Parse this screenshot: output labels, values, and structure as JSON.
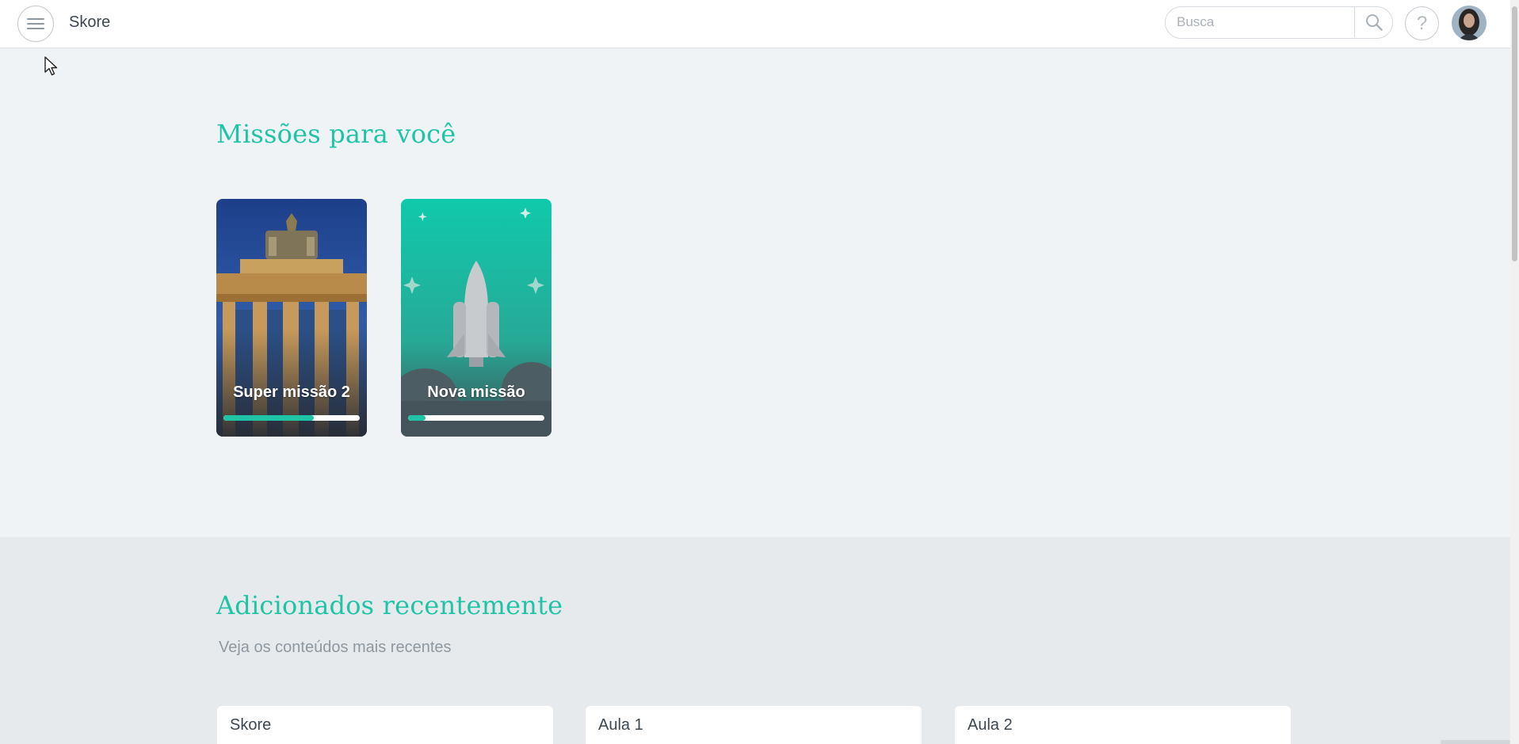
{
  "header": {
    "app_name": "Skore",
    "search_placeholder": "Busca",
    "help_label": "?"
  },
  "missions": {
    "title": "Missões para você",
    "cards": [
      {
        "title": "Super missão 2",
        "progress": 0.66
      },
      {
        "title": "Nova missão",
        "progress": 0.13
      }
    ]
  },
  "recent": {
    "title": "Adicionados recentemente",
    "subtitle": "Veja os conteúdos mais recentes",
    "items": [
      "Skore",
      "Aula 1",
      "Aula 2"
    ]
  },
  "icons": {
    "menu": "hamburger-menu-icon",
    "search": "search-icon",
    "help": "question-mark-icon",
    "cursor": "mouse-pointer-icon"
  },
  "colors": {
    "accent": "#1fc4a6",
    "page_bg": "#eff3f6",
    "recent_bg": "#e6eaed",
    "text": "#3c4750"
  }
}
